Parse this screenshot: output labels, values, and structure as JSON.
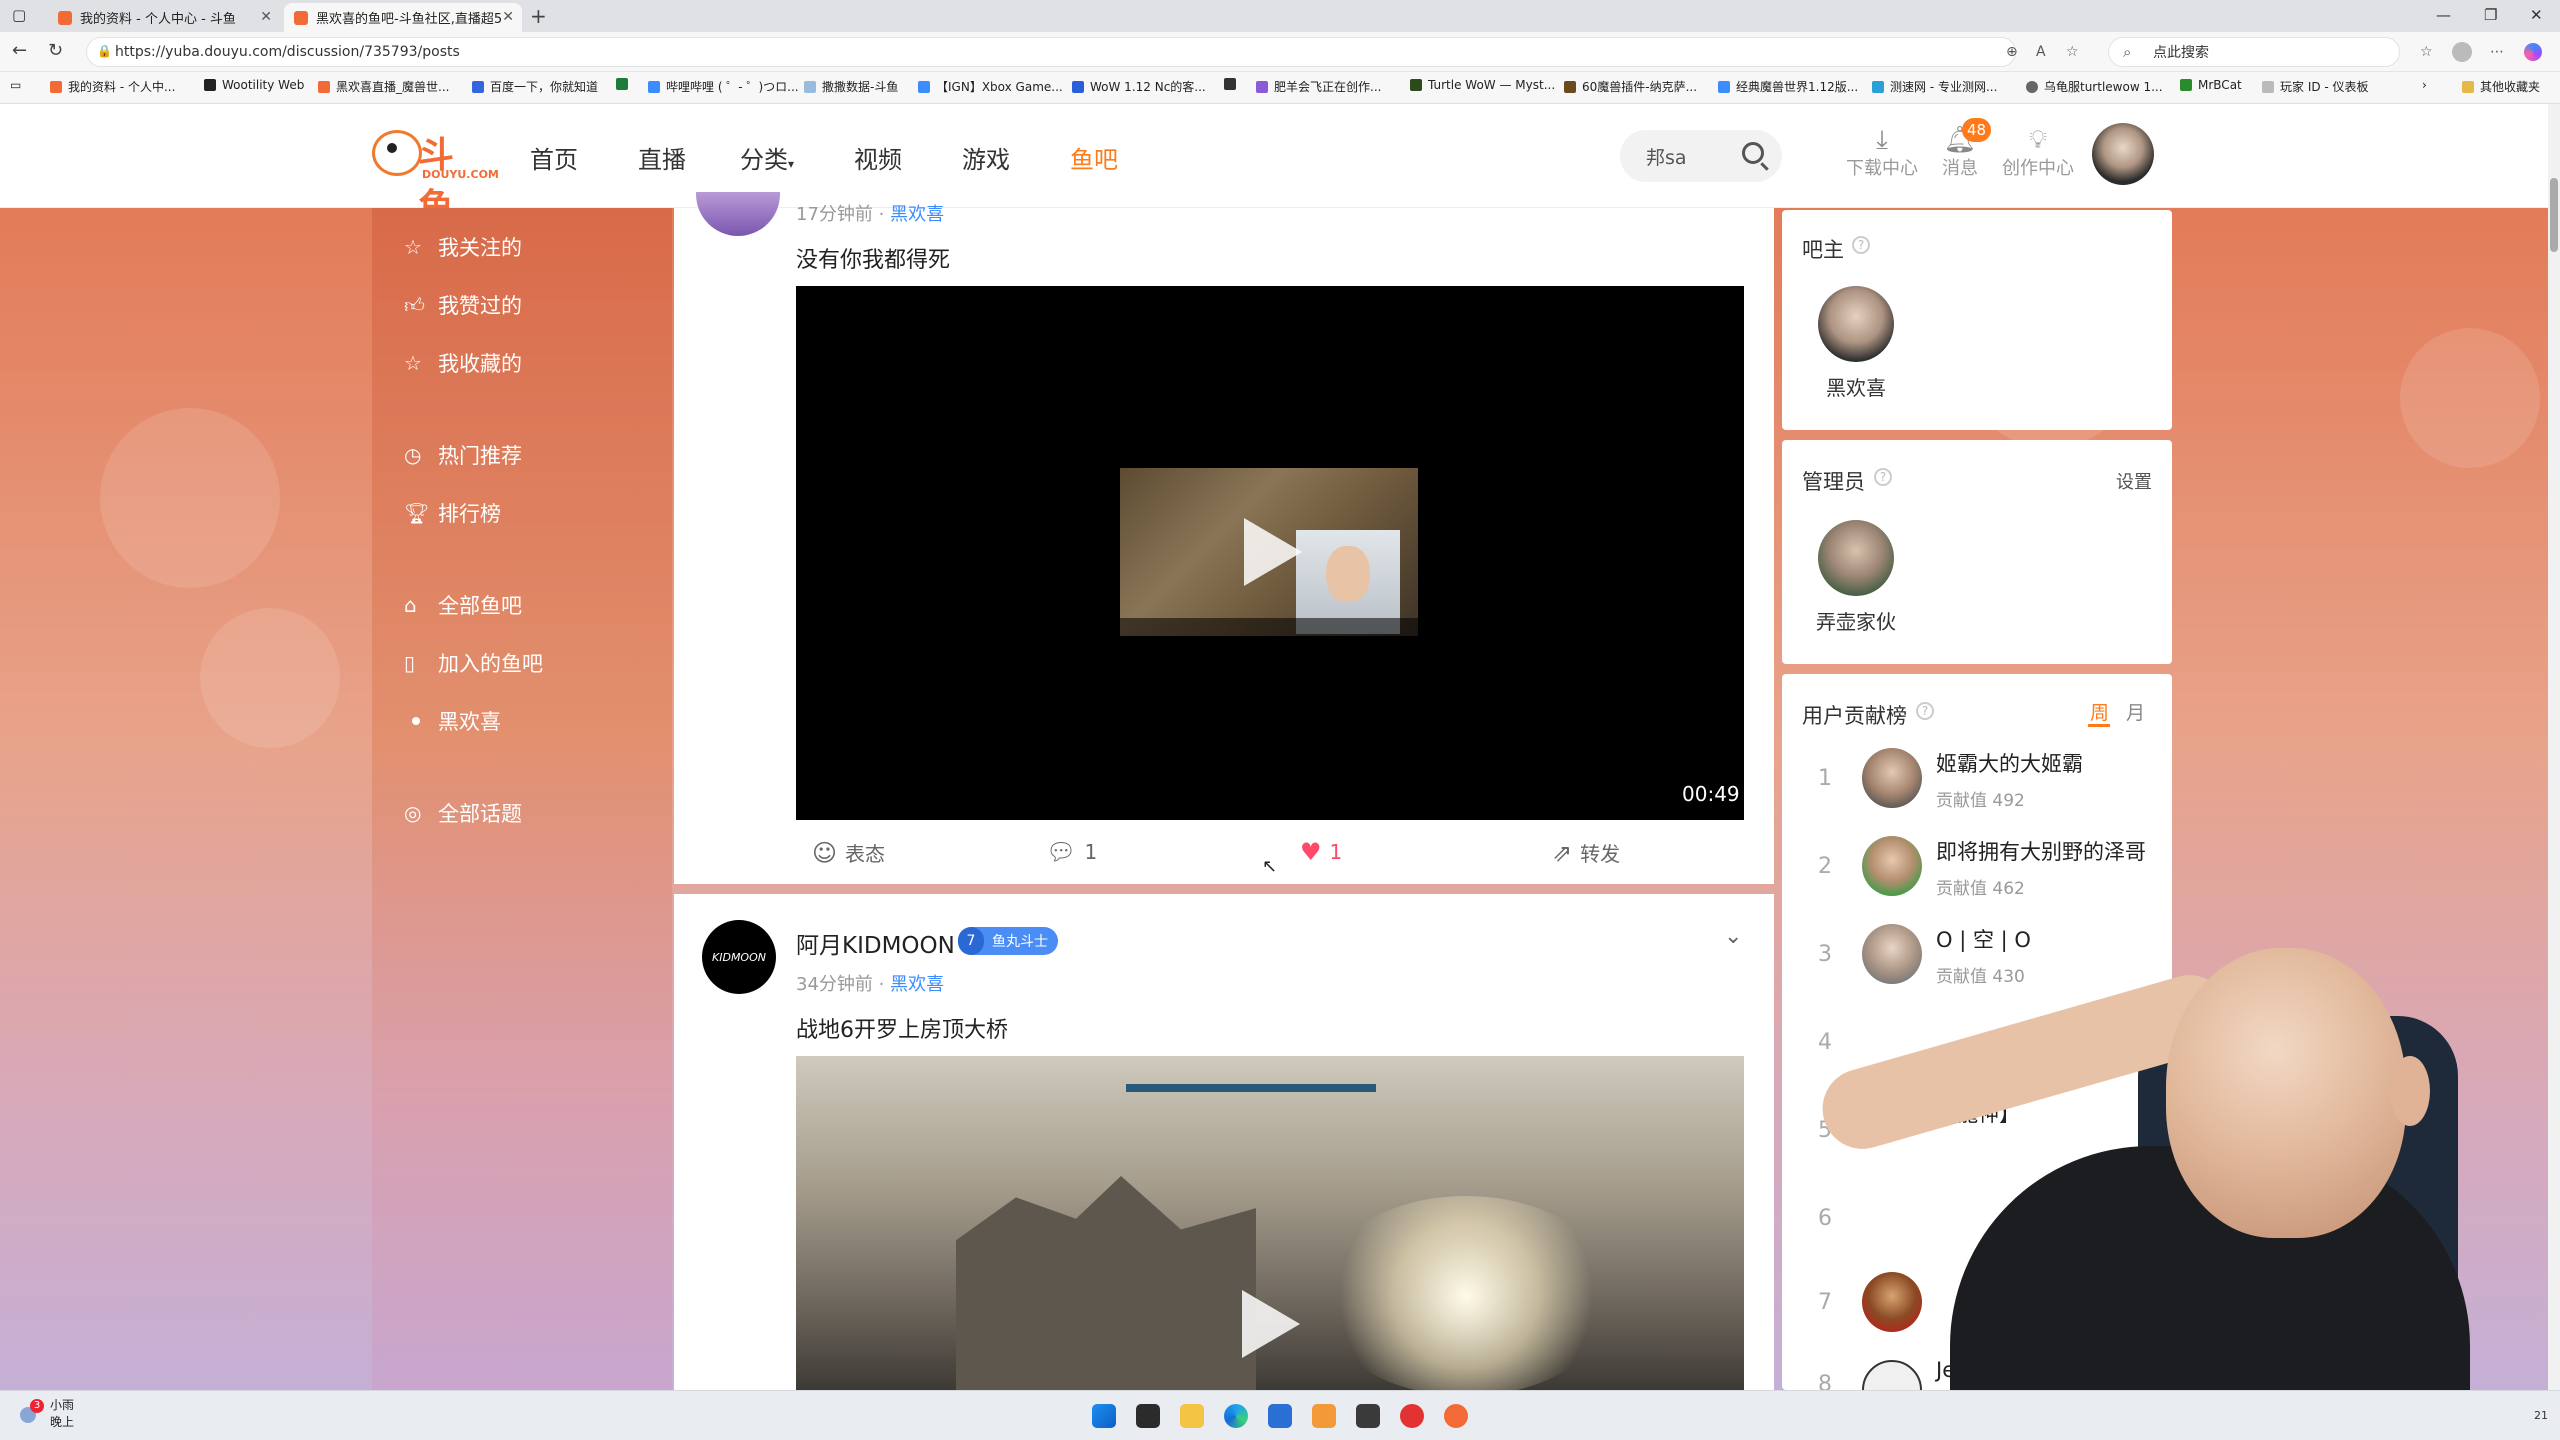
{
  "browser": {
    "tabs": [
      {
        "title": "我的资料 - 个人中心 - 斗鱼",
        "active": false
      },
      {
        "title": "黑欢喜的鱼吧-斗鱼社区,直播超5",
        "active": true
      }
    ],
    "url": "https://yuba.douyu.com/discussion/735793/posts",
    "search_placeholder": "点此搜索",
    "bookmarks": [
      "我的资料 - 个人中...",
      "Wootility Web",
      "黑欢喜直播_魔兽世...",
      "百度一下，你就知道",
      "哔哩哔哩 ( ゜- ゜)つロ...",
      "撒撒数据-斗鱼",
      "【IGN】Xbox Game...",
      "WoW 1.12 Nc的客...",
      "肥羊会飞正在创作...",
      "Turtle WoW — Myst...",
      "60魔兽插件-纳克萨...",
      "经典魔兽世界1.12版...",
      "测速网 - 专业测网...",
      "乌龟服turtlewow 1...",
      "MrBCat",
      "玩家 ID - 仪表板"
    ],
    "bookmarks_other": "其他收藏夹"
  },
  "header": {
    "logo_text": "斗鱼",
    "logo_sub": "DOUYU.COM",
    "nav": [
      {
        "label": "首页",
        "active": false
      },
      {
        "label": "直播",
        "active": false
      },
      {
        "label": "分类",
        "active": false
      },
      {
        "label": "视频",
        "active": false
      },
      {
        "label": "游戏",
        "active": false
      },
      {
        "label": "鱼吧",
        "active": true
      }
    ],
    "search_value": "邦sa",
    "download": "下载中心",
    "messages": "消息",
    "messages_badge": "48",
    "creator": "创作中心",
    "accent_color": "#ff7a1a"
  },
  "sidebar": {
    "items": [
      {
        "label": "我关注的",
        "icon": "star-icon"
      },
      {
        "label": "我赞过的",
        "icon": "thumbs-up-icon"
      },
      {
        "label": "我收藏的",
        "icon": "star-icon"
      },
      {
        "label": "热门推荐",
        "icon": "clock-icon"
      },
      {
        "label": "排行榜",
        "icon": "trophy-icon"
      },
      {
        "label": "全部鱼吧",
        "icon": "home-icon"
      },
      {
        "label": "加入的鱼吧",
        "icon": "bookmark-icon"
      },
      {
        "label": "黑欢喜",
        "icon": "dot-icon"
      },
      {
        "label": "全部话题",
        "icon": "topic-icon"
      }
    ]
  },
  "posts": [
    {
      "time": "17分钟前",
      "group": "黑欢喜",
      "title": "没有你我都得死",
      "duration": "00:49",
      "react_label": "表态",
      "comments": "1",
      "likes": "1",
      "share_label": "转发"
    },
    {
      "author": "阿月KIDMOON",
      "avatar_text": "KIDMOON",
      "level": "7",
      "level_title": "鱼丸斗士",
      "time": "34分钟前",
      "group": "黑欢喜",
      "title": "战地6开罗上房顶大桥"
    }
  ],
  "right": {
    "owner_title": "吧主",
    "owner_name": "黑欢喜",
    "admin_title": "管理员",
    "admin_settings": "设置",
    "admin_name": "弄壶家伙",
    "rank_title": "用户贡献榜",
    "toggle_week": "周",
    "toggle_month": "月",
    "score_label": "贡献值",
    "ranks": [
      {
        "n": "1",
        "name": "姬霸大的大姬霸",
        "score": "492"
      },
      {
        "n": "2",
        "name": "即将拥有大别野的泽哥",
        "score": "462"
      },
      {
        "n": "3",
        "name": "O | 空 | O",
        "score": "430"
      },
      {
        "n": "4",
        "name": "",
        "score": ""
      },
      {
        "n": "5",
        "name": "【龍神】",
        "score": ""
      },
      {
        "n": "6",
        "name": "",
        "score": ""
      },
      {
        "n": "7",
        "name": "",
        "score": ""
      },
      {
        "n": "8",
        "name": "Jektry",
        "score": ""
      }
    ]
  },
  "taskbar": {
    "weather_badge": "3",
    "weather_line1": "小雨",
    "weather_line2": "晚上",
    "clock": "21"
  }
}
